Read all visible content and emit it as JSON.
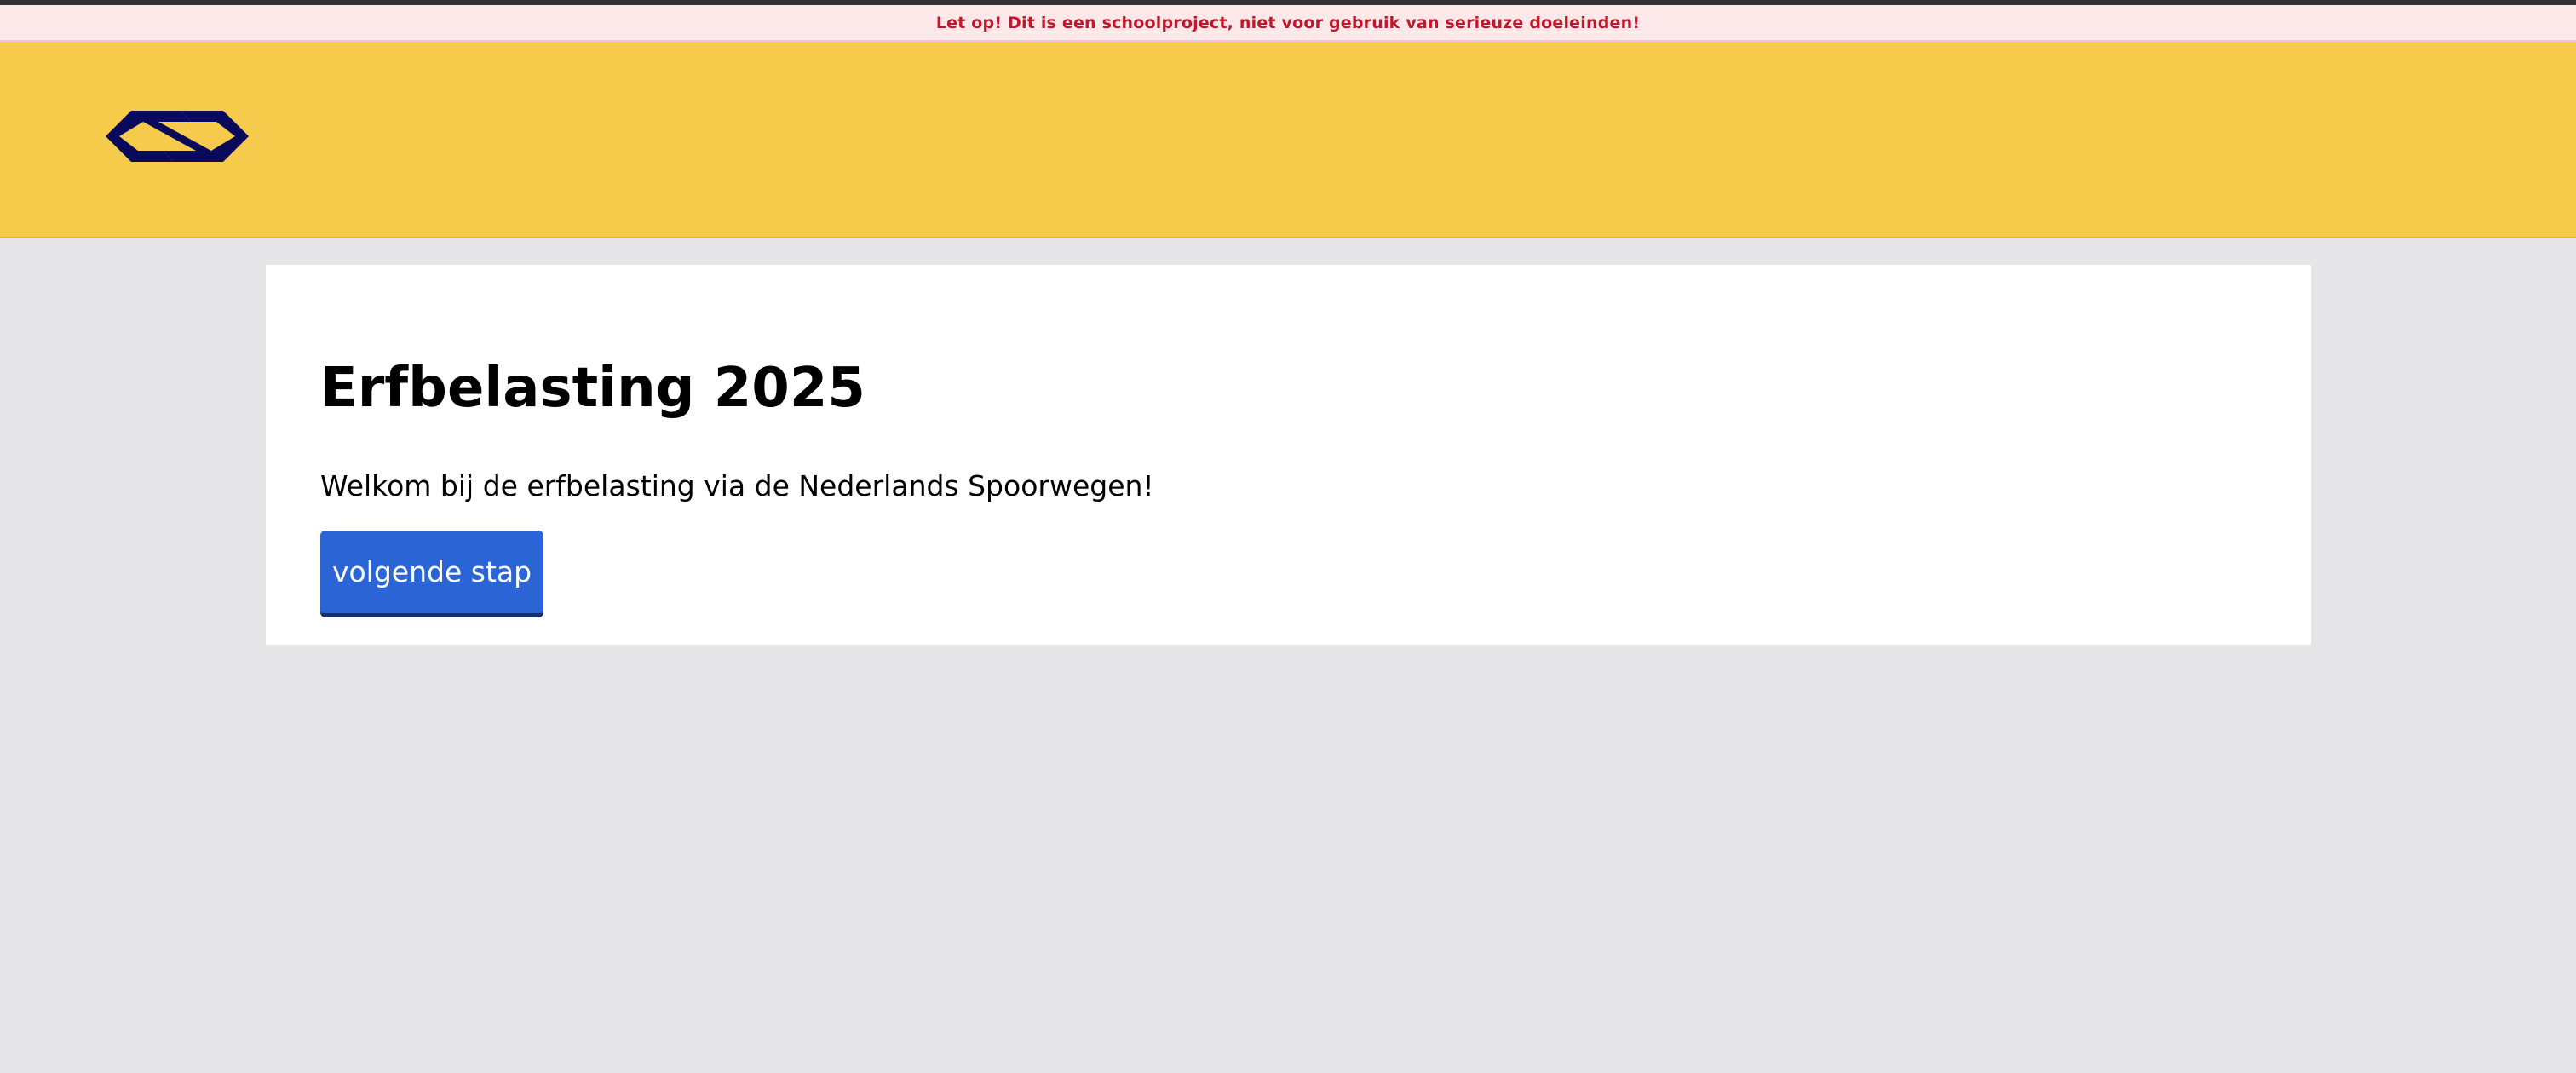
{
  "banner": {
    "warning_text": "Let op! Dit is een schoolproject, niet voor gebruik van serieuze doeleinden!"
  },
  "header": {
    "logo_icon": "ns-logo-icon",
    "background_color": "#f6ca4b",
    "logo_color": "#0a0a5c"
  },
  "main": {
    "title": "Erfbelasting 2025",
    "welcome_text": "Welkom bij de erfbelasting via de Nederlands Spoorwegen!",
    "next_button_label": "volgende stap",
    "button_color": "#2b64d4"
  }
}
